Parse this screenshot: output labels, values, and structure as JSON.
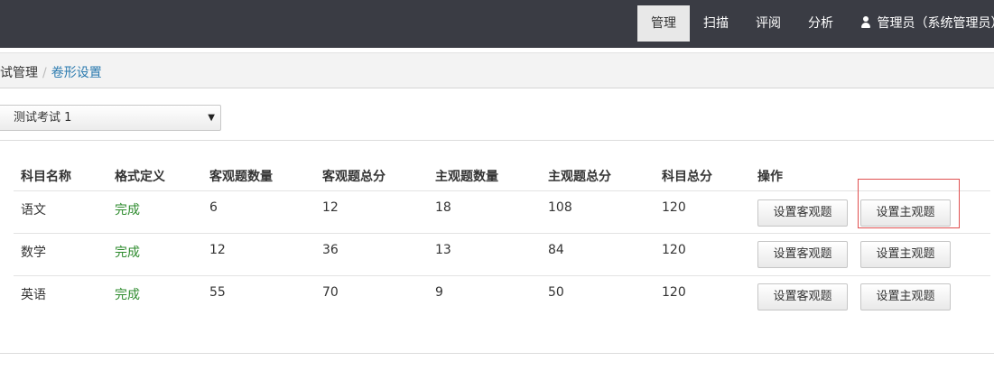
{
  "nav": {
    "manage": "管理",
    "scan": "扫描",
    "review": "评阅",
    "analysis": "分析",
    "user": "管理员（系统管理员）"
  },
  "breadcrumb": {
    "parent": "考试管理",
    "separator": "/",
    "current": "卷形设置"
  },
  "exam_select": {
    "selected": "测试考试 1"
  },
  "table": {
    "headers": [
      "科目名称",
      "格式定义",
      "客观题数量",
      "客观题总分",
      "主观题数量",
      "主观题总分",
      "科目总分",
      "操作"
    ],
    "rows": [
      {
        "subject": "语文",
        "format": "完成",
        "obj_count": "6",
        "obj_score": "12",
        "subj_count": "18",
        "subj_score": "108",
        "total": "120"
      },
      {
        "subject": "数学",
        "format": "完成",
        "obj_count": "12",
        "obj_score": "36",
        "subj_count": "13",
        "subj_score": "84",
        "total": "120"
      },
      {
        "subject": "英语",
        "format": "完成",
        "obj_count": "55",
        "obj_score": "70",
        "subj_count": "9",
        "subj_score": "50",
        "total": "120"
      }
    ],
    "btn_objective": "设置客观题",
    "btn_subjective": "设置主观题"
  },
  "colors": {
    "navbar": "#3a3c44",
    "status_done": "#2e8b2e",
    "link": "#2a7aaf",
    "highlight": "#e05050"
  }
}
